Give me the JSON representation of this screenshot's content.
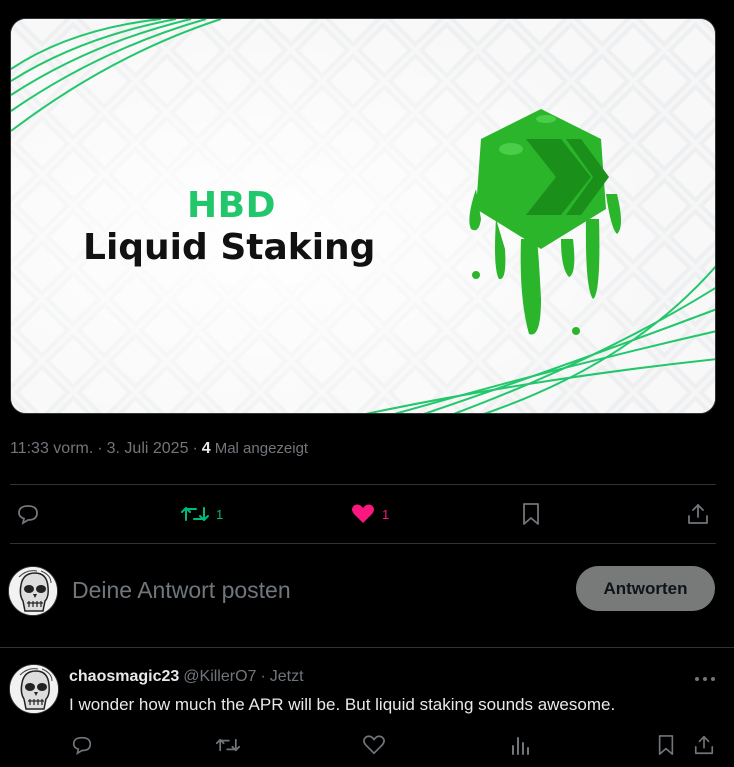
{
  "media": {
    "title_line1": "HBD",
    "title_line2": "Liquid Staking",
    "accent_color": "#22c76b",
    "logo_icon": "hive-logo-green-slime-icon"
  },
  "meta": {
    "time": "11:33 vorm.",
    "separator": "·",
    "date": "3. Juli 2025",
    "views_count": "4",
    "views_label": "Mal angezeigt"
  },
  "actions": {
    "reply_icon": "speech-bubble-icon",
    "retweet_count": "1",
    "retweet_color": "#00ba7c",
    "like_count": "1",
    "like_color": "#f91880",
    "bookmark_icon": "bookmark-icon",
    "share_icon": "share-icon"
  },
  "composer": {
    "placeholder": "Deine Antwort posten",
    "button_label": "Antworten"
  },
  "reply": {
    "display_name": "chaosmagic23",
    "handle": "@KillerO7",
    "separator": "·",
    "time": "Jetzt",
    "text": "I wonder how much the APR will be. But liquid staking sounds awesome.",
    "more_icon": "more-dots-icon"
  }
}
